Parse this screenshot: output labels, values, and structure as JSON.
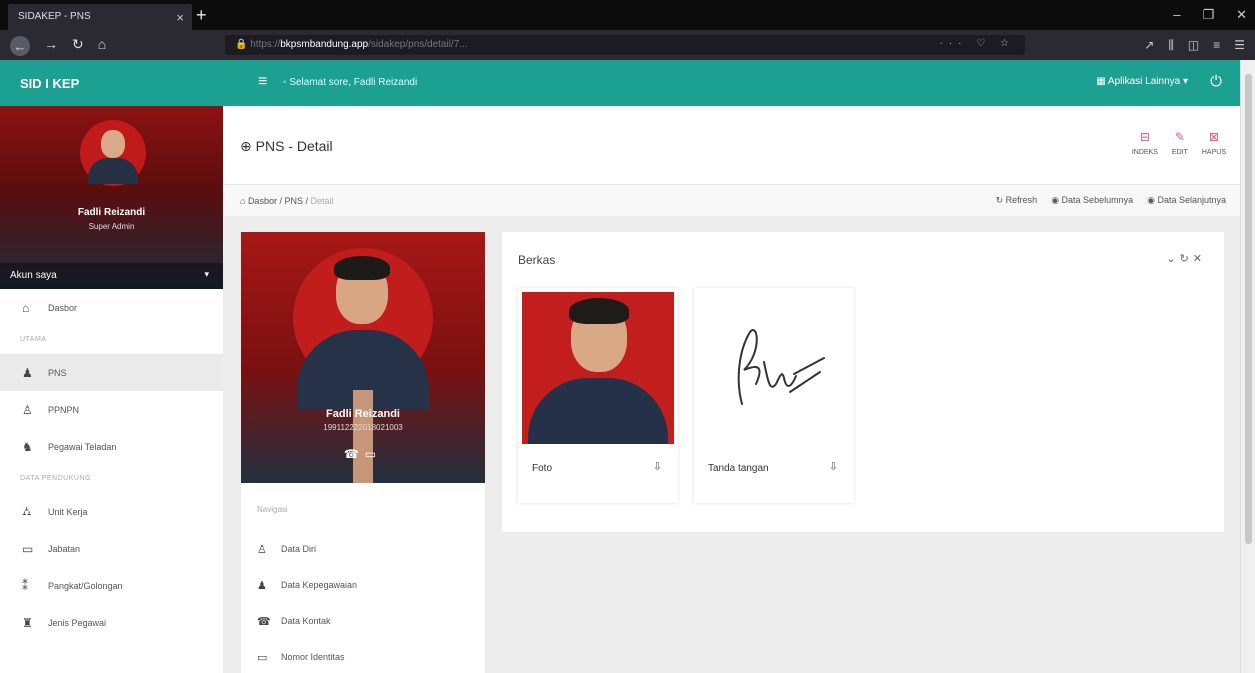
{
  "browser": {
    "tab_title": "SIDAKEP - PNS",
    "url_host": "bkpsmbandung.app",
    "url_scheme": "https://",
    "url_path": "/sidakep/pns/detail/7...",
    "addr_icons": "··· ♡ ☆"
  },
  "app": {
    "brand": "SID I KEP",
    "greeting": "Selamat sore, Fadli Reizandi",
    "apps_menu": "Aplikasi Lainnya",
    "accent_color": "#1ba091"
  },
  "sidebar": {
    "profile_name": "Fadli Reizandi",
    "profile_role": "Super Admin",
    "account_label": "Akun saya",
    "items": [
      {
        "label": "Dasbor",
        "icon": "home-icon"
      },
      {
        "section": "UTAMA"
      },
      {
        "label": "PNS",
        "icon": "user-tie-icon",
        "active": true
      },
      {
        "label": "PPNPN",
        "icon": "user-icon"
      },
      {
        "label": "Pegawai Teladan",
        "icon": "user-star-icon"
      },
      {
        "section": "DATA PENDUKUNG"
      },
      {
        "label": "Unit Kerja",
        "icon": "sitemap-icon"
      },
      {
        "label": "Jabatan",
        "icon": "id-card-icon"
      },
      {
        "label": "Pangkat/Golongan",
        "icon": "rank-icon"
      },
      {
        "label": "Jenis Pegawai",
        "icon": "users-icon"
      }
    ]
  },
  "header": {
    "page_title": "PNS - Detail",
    "actions": [
      {
        "label": "INDEKS",
        "icon": "list-icon"
      },
      {
        "label": "EDIT",
        "icon": "edit-icon"
      },
      {
        "label": "HAPUS",
        "icon": "trash-icon"
      }
    ]
  },
  "breadcrumb": {
    "home": "Dasbor",
    "section": "PNS",
    "current": "Detail",
    "refresh": "Refresh",
    "prev": "Data Sebelumnya",
    "next": "Data Selanjutnya"
  },
  "profile_card": {
    "name": "Fadli Reizandi",
    "nip": "199112222018021003",
    "nav_title": "Navigasi",
    "nav_items": [
      {
        "label": "Data Diri",
        "icon": "user-icon"
      },
      {
        "label": "Data Kepegawaian",
        "icon": "user-tie-icon"
      },
      {
        "label": "Data Kontak",
        "icon": "phone-icon"
      },
      {
        "label": "Nomor Identitas",
        "icon": "id-card-icon"
      }
    ]
  },
  "berkas": {
    "title": "Berkas",
    "files": [
      {
        "label": "Foto",
        "icon": "download-icon"
      },
      {
        "label": "Tanda tangan",
        "icon": "download-icon"
      }
    ]
  }
}
